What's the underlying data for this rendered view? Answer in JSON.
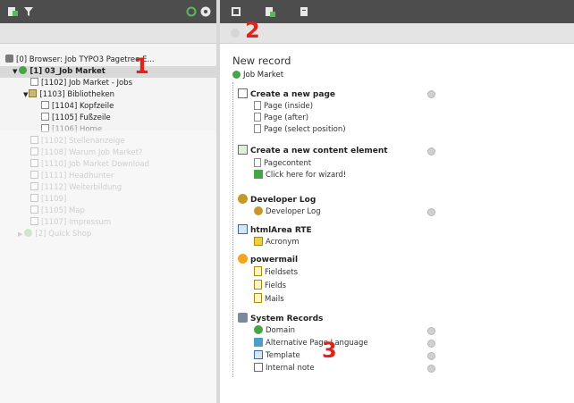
{
  "page_tree": {
    "root_label": "[0] Browser: Job TYPO3 Pagetree E...",
    "items": [
      {
        "label": "[1] 03_Job Market",
        "selected": true
      },
      {
        "label": "[1102] Job Market - Jobs"
      },
      {
        "label": "[1103] Bibliotheken"
      },
      {
        "label": "[1104] Kopfzeile"
      },
      {
        "label": "[1105] Fußzeile"
      },
      {
        "label": "[1106] Home"
      },
      {
        "label": "[1102] Stellenanzeige"
      },
      {
        "label": "[1108] Warum Job Market?"
      },
      {
        "label": "[1110] Job Market Download"
      },
      {
        "label": "[1111] Headhunter"
      },
      {
        "label": "[1112] Weiterbildung"
      },
      {
        "label": "[1109]"
      },
      {
        "label": "[1105] Map"
      },
      {
        "label": "[1107] Impressum"
      },
      {
        "label": "[2] Quick Shop"
      }
    ]
  },
  "markers": {
    "one": "1",
    "two": "2",
    "three": "3"
  },
  "record": {
    "title": "New record",
    "page": "Job Market",
    "sections": [
      {
        "title": "Create a new page",
        "items": [
          "Page (inside)",
          "Page (after)",
          "Page (select position)"
        ]
      },
      {
        "title": "Create a new content element",
        "items": [
          "Pagecontent",
          "Click here for wizard!"
        ]
      },
      {
        "title": "Developer Log",
        "items": [
          "Developer Log"
        ]
      },
      {
        "title": "htmlArea RTE",
        "items": [
          "Acronym"
        ]
      },
      {
        "title": "powermail",
        "items": [
          "Fieldsets",
          "Fields",
          "Mails"
        ]
      },
      {
        "title": "System Records",
        "items": [
          "Domain",
          "Alternative Page Language",
          "Template",
          "Internal note"
        ]
      }
    ]
  },
  "colors": {
    "topbar": "#4d4d4d",
    "marker": "#e2231a",
    "green": "#47a447"
  },
  "icons": {
    "left_toolbar": [
      "new-page-icon",
      "filter-icon",
      "refresh-icon",
      "help-icon"
    ],
    "right_toolbar": [
      "close-icon",
      "new-record-icon",
      "document-icon"
    ]
  }
}
